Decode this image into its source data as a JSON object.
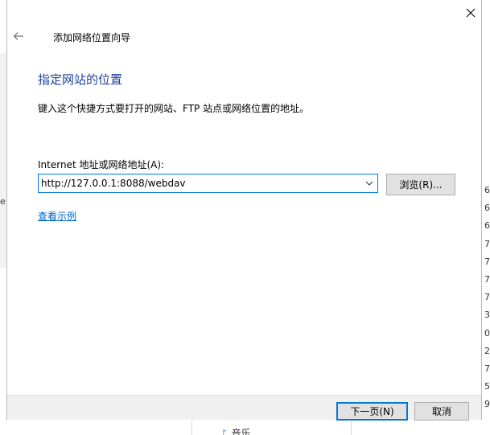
{
  "wizard": {
    "title": "添加网络位置向导",
    "heading": "指定网站的位置",
    "description": "键入这个快捷方式要打开的网站、FTP 站点或网络位置的地址。",
    "address_label": "Internet 地址或网络地址(A):",
    "address_value": "http://127.0.0.1:8088/webdav",
    "browse_label": "浏览(R)...",
    "example_link": "查看示例",
    "next_label": "下一页(N)",
    "cancel_label": "取消"
  },
  "background": {
    "left_char": "e",
    "right_digits": "6\n6\n6\n7\n7\n7\n7\n3\n0\n2\n7\n5\n9",
    "bottom_item": "音乐"
  },
  "colors": {
    "heading": "#1a3f99",
    "link": "#0066cc",
    "focus": "#0078d7",
    "footer": "#f0f0f0"
  },
  "icons": {
    "close": "close-icon",
    "back": "back-arrow-icon",
    "dropdown": "chevron-down-icon",
    "music": "music-note-icon"
  }
}
